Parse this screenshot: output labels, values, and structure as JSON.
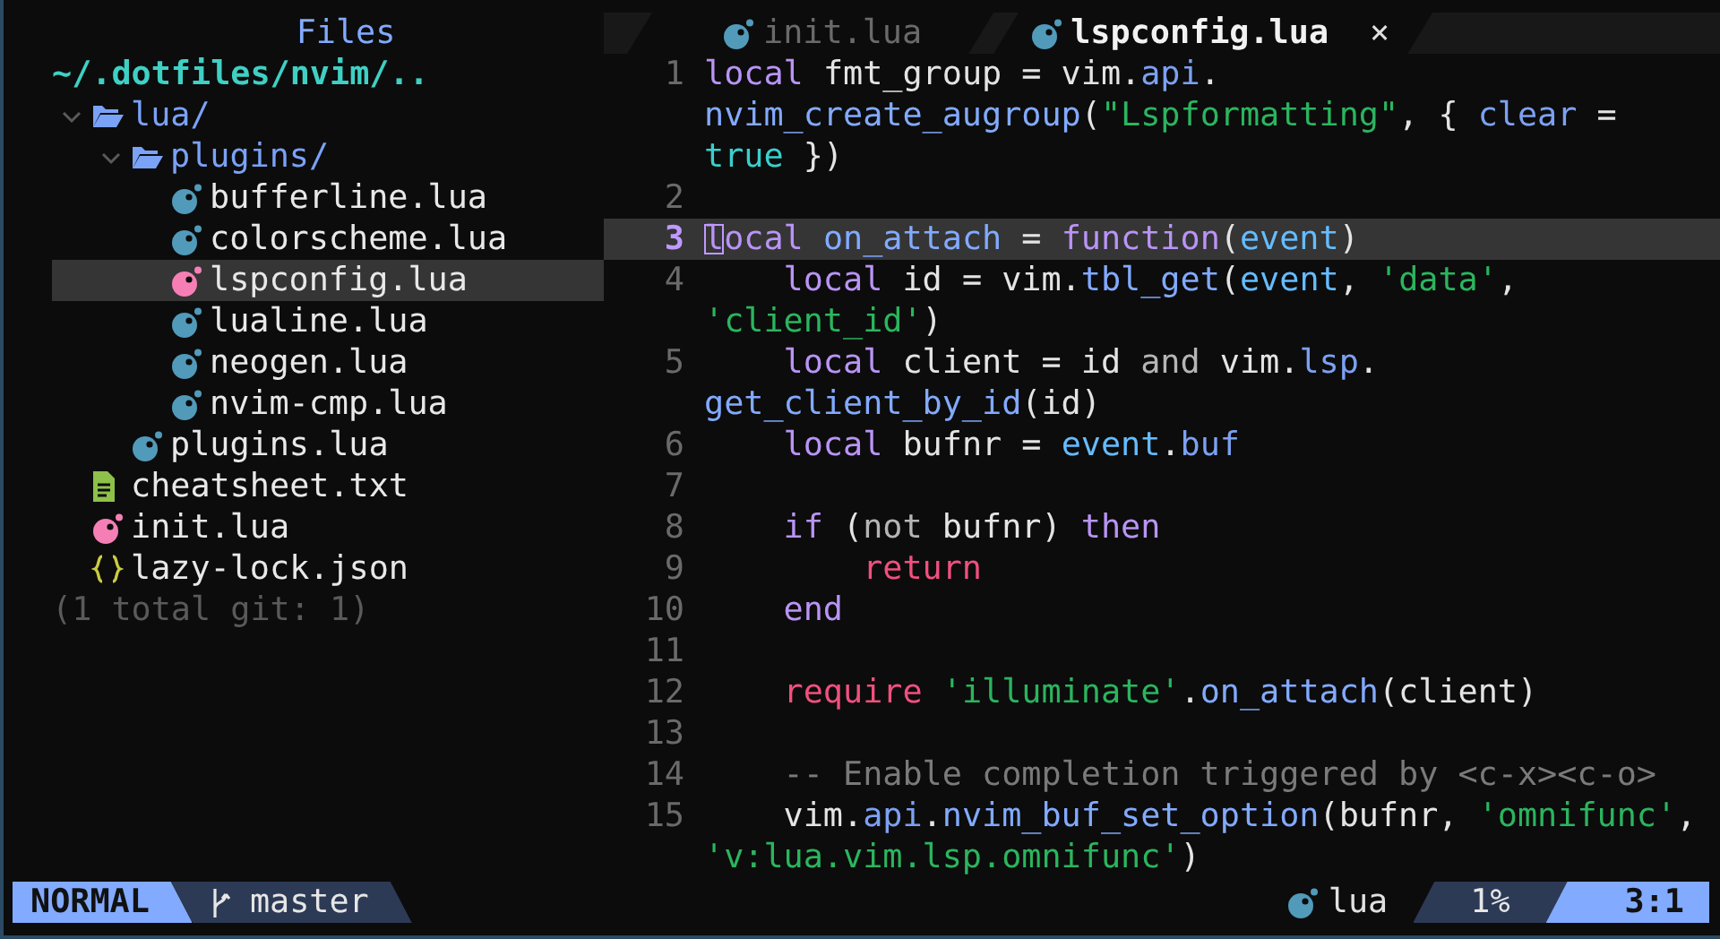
{
  "sidebar": {
    "title": "Files",
    "root": "~/.dotfiles/nvim/..",
    "tree": [
      {
        "name": "lua/",
        "kind": "folder",
        "expanded": true,
        "selected": false,
        "children": [
          {
            "name": "plugins/",
            "kind": "folder",
            "expanded": true,
            "selected": false,
            "children": [
              {
                "name": "bufferline.lua",
                "kind": "lua",
                "color": "#519aba",
                "selected": false
              },
              {
                "name": "colorscheme.lua",
                "kind": "lua",
                "color": "#519aba",
                "selected": false
              },
              {
                "name": "lspconfig.lua",
                "kind": "lua",
                "color": "#f57fb5",
                "selected": true
              },
              {
                "name": "lualine.lua",
                "kind": "lua",
                "color": "#519aba",
                "selected": false
              },
              {
                "name": "neogen.lua",
                "kind": "lua",
                "color": "#519aba",
                "selected": false
              },
              {
                "name": "nvim-cmp.lua",
                "kind": "lua",
                "color": "#519aba",
                "selected": false
              }
            ]
          },
          {
            "name": "plugins.lua",
            "kind": "lua",
            "color": "#519aba",
            "selected": false
          }
        ]
      },
      {
        "name": "cheatsheet.txt",
        "kind": "text",
        "selected": false
      },
      {
        "name": "init.lua",
        "kind": "lua",
        "color": "#f57fb5",
        "selected": false
      },
      {
        "name": "lazy-lock.json",
        "kind": "json",
        "selected": false
      }
    ],
    "footer": "(1 total git: 1)"
  },
  "tabs": [
    {
      "label": "init.lua",
      "selected": false
    },
    {
      "label": "lspconfig.lua",
      "selected": true,
      "close": "×"
    }
  ],
  "editor": {
    "lines": [
      {
        "number": "1",
        "current": false,
        "cursor": false,
        "rows": [
          {
            "segments": [
              {
                "text": "local",
                "color": "#b994f5"
              },
              {
                "text": " fmt_group = vim.",
                "color": "#e4e4e4"
              },
              {
                "text": "api",
                "color": "#7ca1f2"
              },
              {
                "text": ".",
                "color": "#e4e4e4"
              }
            ]
          },
          {
            "segments": [
              {
                "text": "nvim_create_augroup",
                "color": "#82aaff"
              },
              {
                "text": "(",
                "color": "#e4e4e4"
              },
              {
                "text": "\"Lspformatting\"",
                "color": "#2bb55e"
              },
              {
                "text": ", { ",
                "color": "#e4e4e4"
              },
              {
                "text": "clear",
                "color": "#7ca1f2"
              },
              {
                "text": " =",
                "color": "#e4e4e4"
              }
            ]
          },
          {
            "segments": [
              {
                "text": "true",
                "color": "#3ad0cc"
              },
              {
                "text": " })",
                "color": "#e4e4e4"
              }
            ]
          }
        ]
      },
      {
        "number": "2",
        "current": false,
        "cursor": false,
        "rows": [
          {
            "segments": []
          }
        ]
      },
      {
        "number": "3",
        "current": true,
        "cursor": true,
        "rows": [
          {
            "segments": [
              {
                "text": "local ",
                "color": "#b994f5"
              },
              {
                "text": "on_attach",
                "color": "#82aaff"
              },
              {
                "text": " = ",
                "color": "#e4e4e4"
              },
              {
                "text": "function",
                "color": "#b994f5"
              },
              {
                "text": "(",
                "color": "#e4e4e4"
              },
              {
                "text": "event",
                "color": "#65bcff"
              },
              {
                "text": ")",
                "color": "#e4e4e4"
              }
            ]
          }
        ]
      },
      {
        "number": "4",
        "current": false,
        "cursor": false,
        "rows": [
          {
            "segments": [
              {
                "text": "    local",
                "color": "#b994f5"
              },
              {
                "text": " id = vim.",
                "color": "#e4e4e4"
              },
              {
                "text": "tbl_get",
                "color": "#82aaff"
              },
              {
                "text": "(",
                "color": "#e4e4e4"
              },
              {
                "text": "event",
                "color": "#65bcff"
              },
              {
                "text": ", ",
                "color": "#e4e4e4"
              },
              {
                "text": "'data'",
                "color": "#2bb55e"
              },
              {
                "text": ",",
                "color": "#e4e4e4"
              }
            ]
          },
          {
            "segments": [
              {
                "text": "'client_id'",
                "color": "#2bb55e"
              },
              {
                "text": ")",
                "color": "#e4e4e4"
              }
            ]
          }
        ]
      },
      {
        "number": "5",
        "current": false,
        "cursor": false,
        "rows": [
          {
            "segments": [
              {
                "text": "    local",
                "color": "#b994f5"
              },
              {
                "text": " client = id ",
                "color": "#e4e4e4"
              },
              {
                "text": "and",
                "color": "#b5b5b5"
              },
              {
                "text": " vim.",
                "color": "#e4e4e4"
              },
              {
                "text": "lsp",
                "color": "#7ca1f2"
              },
              {
                "text": ".",
                "color": "#e4e4e4"
              }
            ]
          },
          {
            "segments": [
              {
                "text": "get_client_by_id",
                "color": "#82aaff"
              },
              {
                "text": "(id)",
                "color": "#e4e4e4"
              }
            ]
          }
        ]
      },
      {
        "number": "6",
        "current": false,
        "cursor": false,
        "rows": [
          {
            "segments": [
              {
                "text": "    local",
                "color": "#b994f5"
              },
              {
                "text": " bufnr = ",
                "color": "#e4e4e4"
              },
              {
                "text": "event",
                "color": "#65bcff"
              },
              {
                "text": ".",
                "color": "#e4e4e4"
              },
              {
                "text": "buf",
                "color": "#7ca1f2"
              }
            ]
          }
        ]
      },
      {
        "number": "7",
        "current": false,
        "cursor": false,
        "rows": [
          {
            "segments": []
          }
        ]
      },
      {
        "number": "8",
        "current": false,
        "cursor": false,
        "rows": [
          {
            "segments": [
              {
                "text": "    if",
                "color": "#b994f5"
              },
              {
                "text": " (",
                "color": "#e4e4e4"
              },
              {
                "text": "not",
                "color": "#b5b5b5"
              },
              {
                "text": " bufnr) ",
                "color": "#e4e4e4"
              },
              {
                "text": "then",
                "color": "#b994f5"
              }
            ]
          }
        ]
      },
      {
        "number": "9",
        "current": false,
        "cursor": false,
        "rows": [
          {
            "segments": [
              {
                "text": "        return",
                "color": "#f0507f"
              }
            ]
          }
        ]
      },
      {
        "number": "10",
        "current": false,
        "cursor": false,
        "rows": [
          {
            "segments": [
              {
                "text": "    end",
                "color": "#b994f5"
              }
            ]
          }
        ]
      },
      {
        "number": "11",
        "current": false,
        "cursor": false,
        "rows": [
          {
            "segments": []
          }
        ]
      },
      {
        "number": "12",
        "current": false,
        "cursor": false,
        "rows": [
          {
            "segments": [
              {
                "text": "    require ",
                "color": "#f0507f"
              },
              {
                "text": "'illuminate'",
                "color": "#2bb55e"
              },
              {
                "text": ".",
                "color": "#e4e4e4"
              },
              {
                "text": "on_attach",
                "color": "#82aaff"
              },
              {
                "text": "(client)",
                "color": "#e4e4e4"
              }
            ]
          }
        ]
      },
      {
        "number": "13",
        "current": false,
        "cursor": false,
        "rows": [
          {
            "segments": []
          }
        ]
      },
      {
        "number": "14",
        "current": false,
        "cursor": false,
        "rows": [
          {
            "segments": [
              {
                "text": "    -- Enable completion triggered by <c-x><c-o>",
                "color": "#7a7a7a"
              }
            ]
          }
        ]
      },
      {
        "number": "15",
        "current": false,
        "cursor": false,
        "rows": [
          {
            "segments": [
              {
                "text": "    vim.",
                "color": "#e4e4e4"
              },
              {
                "text": "api",
                "color": "#7ca1f2"
              },
              {
                "text": ".",
                "color": "#e4e4e4"
              },
              {
                "text": "nvim_buf_set_option",
                "color": "#82aaff"
              },
              {
                "text": "(bufnr, ",
                "color": "#e4e4e4"
              },
              {
                "text": "'omnifunc'",
                "color": "#2bb55e"
              },
              {
                "text": ",",
                "color": "#e4e4e4"
              }
            ]
          },
          {
            "segments": [
              {
                "text": "'v:lua.vim.lsp.omnifunc'",
                "color": "#2bb55e"
              },
              {
                "text": ")",
                "color": "#e4e4e4"
              }
            ]
          }
        ]
      }
    ]
  },
  "status_bar": {
    "mode": "NORMAL",
    "branch": "master",
    "filetype": "lua",
    "progress": "1%",
    "position": "3:1"
  }
}
